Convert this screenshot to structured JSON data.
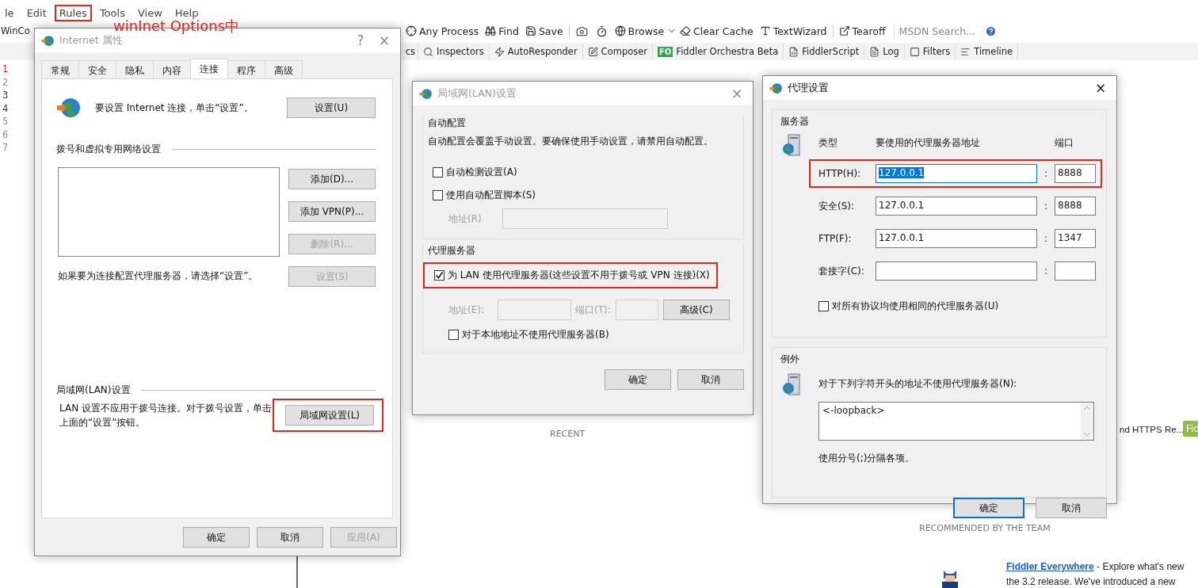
{
  "app": {
    "menu": [
      {
        "label": "le",
        "highlighted": false
      },
      {
        "label": "Edit",
        "highlighted": false
      },
      {
        "label": "Rules",
        "highlighted": true
      },
      {
        "label": "Tools",
        "highlighted": false
      },
      {
        "label": "View",
        "highlighted": false
      },
      {
        "label": "Help",
        "highlighted": false
      }
    ],
    "annotation": "winInet Options中",
    "toolbar_left": "WinCo",
    "toolbar": [
      "Any Process",
      "Find",
      "Save",
      "Browse",
      "Clear Cache",
      "TextWizard",
      "Tearoff"
    ],
    "search": {
      "placeholder": "MSDN Search..."
    },
    "tabs_left": "cs",
    "tabs": [
      "Inspectors",
      "AutoResponder",
      "Composer",
      "Fiddler Orchestra Beta",
      "FiddlerScript",
      "Log",
      "Filters",
      "Timeline"
    ],
    "orchestra_badge": "FO",
    "sessions": [
      {
        "number": "1",
        "color": "#e0201c"
      },
      {
        "number": "2",
        "color": "#8a8a8a"
      },
      {
        "number": "3",
        "color": "#3a3a3a"
      },
      {
        "number": "4",
        "color": "#3a3a3a"
      },
      {
        "number": "5",
        "color": "#8a8a8a"
      },
      {
        "number": "6",
        "color": "#8a8a8a"
      },
      {
        "number": "7",
        "color": "#8a8a8a"
      }
    ],
    "start_page": {
      "recent": "RECENT",
      "recent_item": "nd HTTPS Re...",
      "recent_button": "Fid",
      "recommended": "RECOMMENDED BY THE TEAM",
      "article": {
        "link": "Fiddler Everywhere",
        "text": "- Explore what's new",
        "continuation": "the 3.2 release. We've introduced a new"
      }
    }
  },
  "internet_properties": {
    "title": "Internet 属性",
    "active": false,
    "help": "?",
    "close": "×",
    "tabs": [
      {
        "label": "常规",
        "selected": false
      },
      {
        "label": "安全",
        "selected": false
      },
      {
        "label": "隐私",
        "selected": false
      },
      {
        "label": "内容",
        "selected": false
      },
      {
        "label": "连接",
        "selected": true
      },
      {
        "label": "程序",
        "selected": false
      },
      {
        "label": "高级",
        "selected": false
      }
    ],
    "setup_text": "要设置 Internet 连接，单击“设置”。",
    "setup_button": {
      "label": "设置(U)",
      "disabled": false
    },
    "dialup_heading": "拨号和虚拟专用网络设置",
    "dialup_buttons": [
      {
        "label": "添加(D)...",
        "disabled": false
      },
      {
        "label": "添加 VPN(P)...",
        "disabled": false
      },
      {
        "label": "删除(R)...",
        "disabled": true
      },
      {
        "label": "设置(S)",
        "disabled": true
      }
    ],
    "proxy_hint": "如果要为连接配置代理服务器，请选择“设置”。",
    "lan_heading": "局域网(LAN)设置",
    "lan_text": "LAN 设置不应用于拨号连接。对于拨号设置，单击上面的“设置”按钮。",
    "lan_button": {
      "label": "局域网设置(L)",
      "disabled": false,
      "highlighted": true
    },
    "buttons": [
      {
        "label": "确定",
        "disabled": false
      },
      {
        "label": "取消",
        "disabled": false
      },
      {
        "label": "应用(A)",
        "disabled": true
      }
    ]
  },
  "lan_settings": {
    "title": "局域网(LAN)设置",
    "active": false,
    "close": "×",
    "auto_heading": "自动配置",
    "auto_text": "自动配置会覆盖手动设置。要确保使用手动设置，请禁用自动配置。",
    "auto_detect": {
      "label": "自动检测设置(A)",
      "checked": false
    },
    "auto_script": {
      "label": "使用自动配置脚本(S)",
      "checked": false
    },
    "script_address_label": "地址(R)",
    "proxy_heading": "代理服务器",
    "use_proxy": {
      "label": "为 LAN 使用代理服务器(这些设置不用于拨号或 VPN 连接)(X)",
      "checked": true,
      "highlighted": true
    },
    "address_label": "地址(E):",
    "port_label": "端口(T):",
    "advanced_button": "高级(C)",
    "bypass_local": {
      "label": "对于本地地址不使用代理服务器(B)",
      "checked": false
    },
    "buttons": [
      {
        "label": "确定",
        "disabled": false
      },
      {
        "label": "取消",
        "disabled": false
      }
    ]
  },
  "proxy_settings": {
    "title": "代理设置",
    "active": true,
    "close": "×",
    "servers_heading": "服务器",
    "columns": [
      "类型",
      "要使用的代理服务器地址",
      "端口"
    ],
    "rows": [
      {
        "label": "HTTP(H):",
        "address": "127.0.0.1",
        "port": "8888",
        "address_selected": true,
        "highlighted": true
      },
      {
        "label": "安全(S):",
        "address": "127.0.0.1",
        "port": "8888",
        "address_selected": false,
        "highlighted": false
      },
      {
        "label": "FTP(F):",
        "address": "127.0.0.1",
        "port": "1347",
        "address_selected": false,
        "highlighted": false
      },
      {
        "label": "套接字(C):",
        "address_selected": false,
        "highlighted": false
      }
    ],
    "separator": ":",
    "same_proxy": {
      "label": "对所有协议均使用相同的代理服务器(U)",
      "checked": false
    },
    "exceptions_heading": "例外",
    "exceptions_text": "对于下列字符开头的地址不使用代理服务器(N):",
    "exceptions_value": "<-loopback>",
    "exceptions_note": "使用分号(;)分隔各项。",
    "buttons": [
      {
        "label": "确定",
        "focused": true
      },
      {
        "label": "取消",
        "focused": false
      }
    ]
  }
}
